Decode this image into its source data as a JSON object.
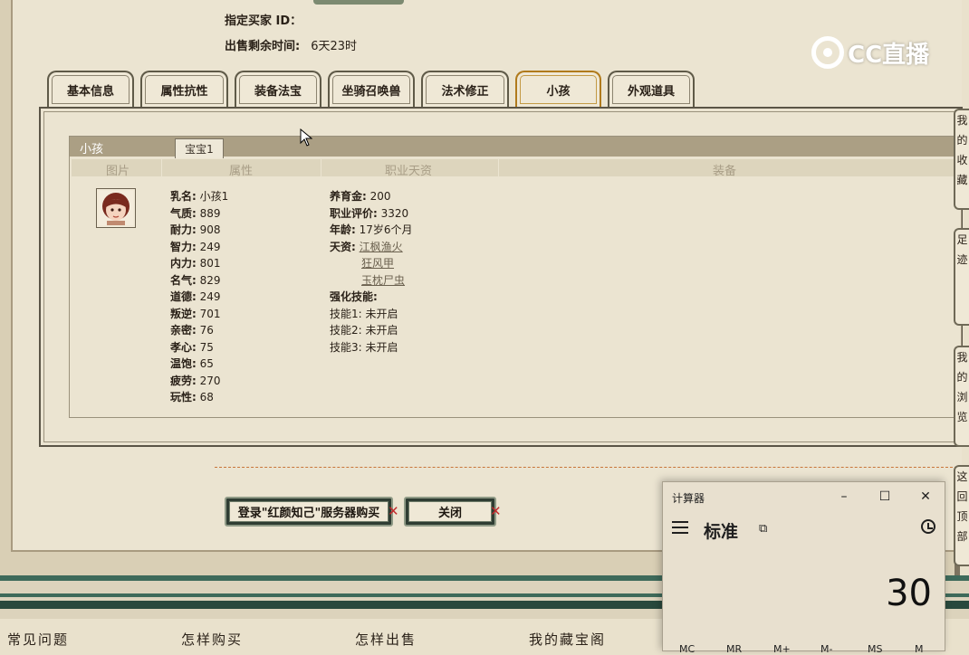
{
  "header": {
    "buyer_id_label": "指定买家 ID：",
    "time_left_label": "出售剩余时间:",
    "time_left_value": "6天23时"
  },
  "logo": {
    "text": "CC直播"
  },
  "tabs": [
    {
      "label": "基本信息",
      "active": false
    },
    {
      "label": "属性抗性",
      "active": false
    },
    {
      "label": "装备法宝",
      "active": false
    },
    {
      "label": "坐骑召唤兽",
      "active": false
    },
    {
      "label": "法术修正",
      "active": false
    },
    {
      "label": "小孩",
      "active": true
    },
    {
      "label": "外观道具",
      "active": false
    }
  ],
  "child_panel": {
    "title": "小孩",
    "subtab": "宝宝1",
    "columns": [
      "图片",
      "属性",
      "职业天资",
      "装备"
    ],
    "attributes": [
      {
        "k": "乳名:",
        "v": "小孩1"
      },
      {
        "k": "气质:",
        "v": "889"
      },
      {
        "k": "耐力:",
        "v": "908"
      },
      {
        "k": "智力:",
        "v": "249"
      },
      {
        "k": "内力:",
        "v": "801"
      },
      {
        "k": "名气:",
        "v": "829"
      },
      {
        "k": "道德:",
        "v": "249"
      },
      {
        "k": "叛逆:",
        "v": "701"
      },
      {
        "k": "亲密:",
        "v": "76"
      },
      {
        "k": "孝心:",
        "v": "75"
      },
      {
        "k": "温饱:",
        "v": "65"
      },
      {
        "k": "疲劳:",
        "v": "270"
      },
      {
        "k": "玩性:",
        "v": "68"
      }
    ],
    "job": {
      "raise_money_label": "养育金:",
      "raise_money_value": "200",
      "job_rating_label": "职业评价:",
      "job_rating_value": "3320",
      "age_label": "年龄:",
      "age_value": "17岁6个月",
      "talent_label": "天资:",
      "talents": [
        "江枫渔火",
        "狂风甲",
        "玉枕尸虫"
      ],
      "enhance_label": "强化技能:",
      "skills": [
        {
          "k": "技能1:",
          "v": "未开启"
        },
        {
          "k": "技能2:",
          "v": "未开启"
        },
        {
          "k": "技能3:",
          "v": "未开启"
        }
      ]
    }
  },
  "buttons": {
    "login_buy": "登录\"红颜知己\"服务器购买",
    "close": "关闭"
  },
  "footer": {
    "links": [
      "常见问题",
      "怎样购买",
      "怎样出售",
      "我的藏宝阁"
    ]
  },
  "side_notes": [
    "我的收藏",
    "足迹",
    "我的浏览",
    "这回顶部"
  ],
  "calculator": {
    "app_title": "计算器",
    "mode": "标准",
    "display": "30",
    "memory_keys": [
      "MC",
      "MR",
      "M+",
      "M-",
      "MS",
      "M"
    ]
  }
}
